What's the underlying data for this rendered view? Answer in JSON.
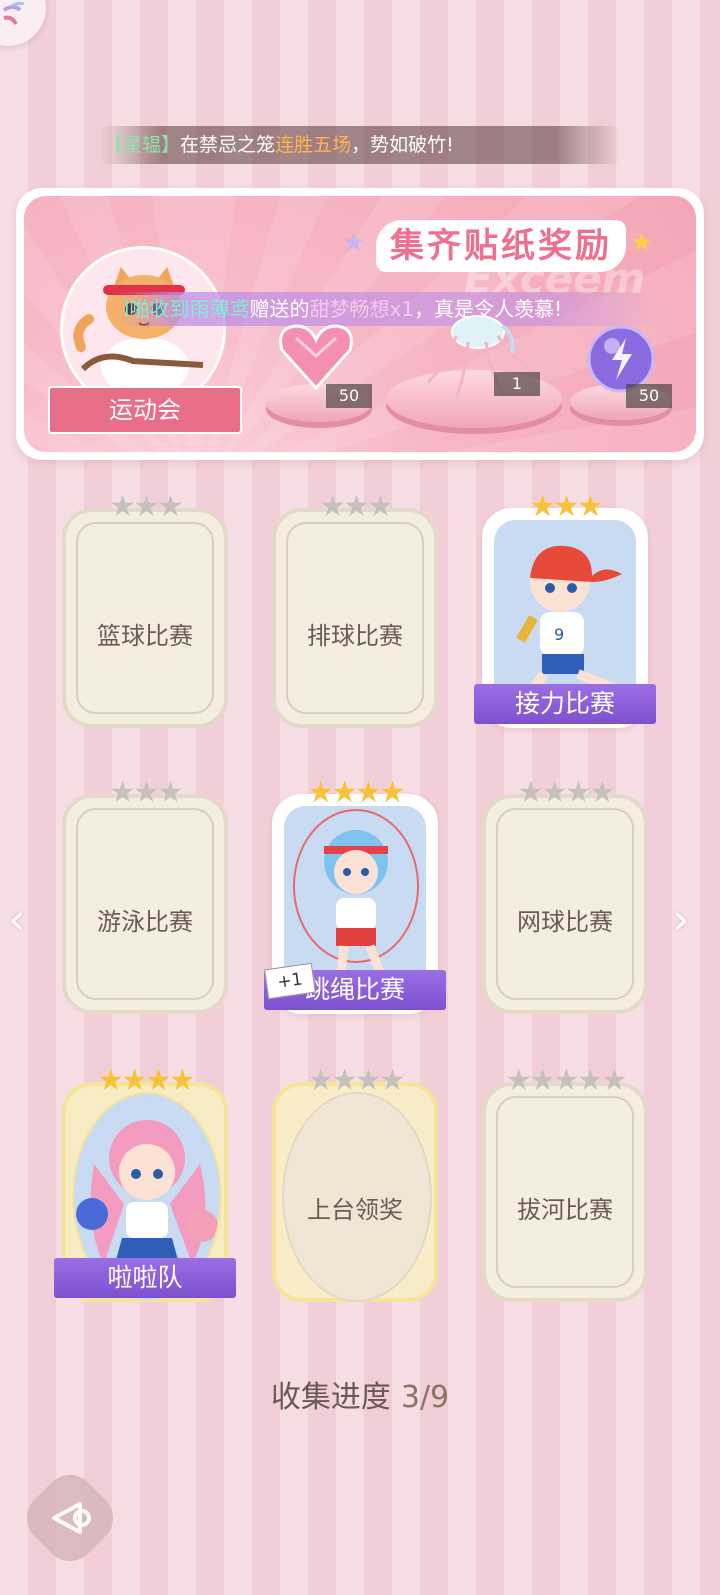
{
  "ticker": {
    "bracket_open": "【",
    "player": "星辒",
    "bracket_close": "】",
    "text1": "在禁忌之笼",
    "highlight": "连胜五场",
    "text2": "，势如破竹!"
  },
  "banner": {
    "title": "集齐贴纸奖励",
    "ghost_text": "Exceem",
    "event_name": "运动会",
    "congrats": {
      "prefix": "l啪收到",
      "giver": "雨薄鸢",
      "middle": "赠送的",
      "gift": "甜梦畅想x1",
      "suffix": "，真是令人羡慕!"
    },
    "rewards": [
      {
        "name": "heart-gem",
        "count": "50"
      },
      {
        "name": "jellyfish-outfit",
        "count": "1"
      },
      {
        "name": "lightning-orb",
        "count": "50"
      }
    ]
  },
  "cards": [
    {
      "label": "篮球比赛",
      "stars_total": 3,
      "stars_gold": 0,
      "state": "locked"
    },
    {
      "label": "排球比赛",
      "stars_total": 3,
      "stars_gold": 0,
      "state": "locked"
    },
    {
      "label": "接力比赛",
      "stars_total": 3,
      "stars_gold": 3,
      "state": "collected"
    },
    {
      "label": "游泳比赛",
      "stars_total": 3,
      "stars_gold": 0,
      "state": "locked"
    },
    {
      "label": "跳绳比赛",
      "stars_total": 4,
      "stars_gold": 4,
      "state": "collected",
      "badge": "+1"
    },
    {
      "label": "网球比赛",
      "stars_total": 4,
      "stars_gold": 0,
      "state": "locked"
    },
    {
      "label": "啦啦队",
      "stars_total": 4,
      "stars_gold": 4,
      "state": "collected"
    },
    {
      "label": "上台领奖",
      "stars_total": 4,
      "stars_gold": 0,
      "state": "locked-gold"
    },
    {
      "label": "拔河比赛",
      "stars_total": 5,
      "stars_gold": 0,
      "state": "locked"
    }
  ],
  "progress": {
    "label": "收集进度",
    "value": "3/9"
  },
  "colors": {
    "accent_pink": "#ee6f8e",
    "plate_purple": "#8a5cd8",
    "star_gold": "#f5c23a",
    "star_gray": "#c7c1bd"
  }
}
